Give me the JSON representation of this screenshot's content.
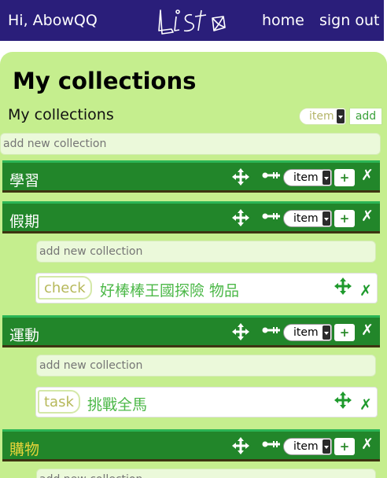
{
  "header": {
    "greeting": "Hi, AbowQQ",
    "logo_text": "Listo",
    "nav": {
      "home": "home",
      "sign_out": "sign out"
    }
  },
  "page": {
    "title": "My collections",
    "subtitle": "My collections",
    "add_type_value": "item",
    "add_button": "add",
    "new_collection_placeholder": "add new collection"
  },
  "collections": [
    {
      "name": "學習",
      "type_value": "item",
      "add_label": "+",
      "delete_label": "✗"
    },
    {
      "name": "假期",
      "type_value": "item",
      "add_label": "+",
      "delete_label": "✗",
      "new_placeholder": "add new collection",
      "items": [
        {
          "badge": "check",
          "text": "好棒棒王國探險 物品",
          "delete_label": "✗"
        }
      ]
    },
    {
      "name": "運動",
      "type_value": "item",
      "add_label": "+",
      "delete_label": "✗",
      "new_placeholder": "add new collection",
      "items": [
        {
          "badge": "task",
          "text": "挑戰全馬",
          "delete_label": "✗"
        }
      ]
    },
    {
      "name": "購物",
      "type_value": "item",
      "add_label": "+",
      "delete_label": "✗",
      "name_color": "#e7d43a",
      "new_placeholder": "add new collection"
    }
  ],
  "colors": {
    "topbar": "#2a1e7a",
    "page_bg": "#c5ee8e",
    "collection_bar": "#22862a",
    "item_text": "#4cb848",
    "highlight_name": "#e7d43a"
  },
  "icons": {
    "move": "move-arrows-icon",
    "key": "key-icon",
    "delete": "delete-x-icon",
    "dropdown": "dropdown-arrow-icon"
  }
}
